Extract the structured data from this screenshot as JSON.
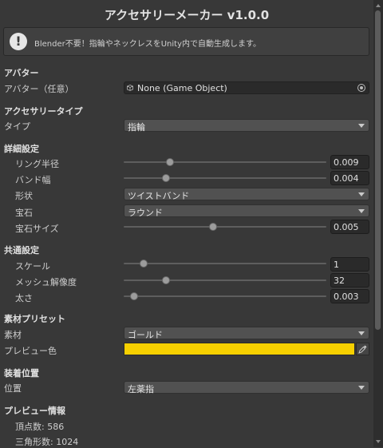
{
  "title": "アクセサリーメーカー v1.0.0",
  "help": {
    "icon": "info-icon",
    "message": "Blender不要！指輪やネックレスをUnity内で自動生成します。"
  },
  "avatar_section": {
    "header": "アバター",
    "field_label": "アバター（任意）",
    "field_value": "None (Game Object)",
    "field_icon": "gameobject-icon",
    "picker_icon": "object-picker-icon"
  },
  "type_section": {
    "header": "アクセサリータイプ",
    "label": "タイプ",
    "value": "指輪"
  },
  "detail_section": {
    "header": "詳細設定",
    "ring_radius": {
      "label": "リング半径",
      "value": "0.009",
      "fraction": 0.23
    },
    "band_width": {
      "label": "バンド幅",
      "value": "0.004",
      "fraction": 0.21
    },
    "shape": {
      "label": "形状",
      "value": "ツイストバンド"
    },
    "gem": {
      "label": "宝石",
      "value": "ラウンド"
    },
    "gem_size": {
      "label": "宝石サイズ",
      "value": "0.005",
      "fraction": 0.44
    }
  },
  "common_section": {
    "header": "共通設定",
    "scale": {
      "label": "スケール",
      "value": "1",
      "fraction": 0.1
    },
    "mesh_resolution": {
      "label": "メッシュ解像度",
      "value": "32",
      "fraction": 0.21
    },
    "thickness": {
      "label": "太さ",
      "value": "0.003",
      "fraction": 0.05
    }
  },
  "material_section": {
    "header": "素材プリセット",
    "material": {
      "label": "素材",
      "value": "ゴールド"
    },
    "preview_color": {
      "label": "プレビュー色",
      "color": "#F7D000",
      "picker_icon": "eyedropper-icon"
    }
  },
  "position_section": {
    "header": "装着位置",
    "label": "位置",
    "value": "左薬指"
  },
  "preview_section": {
    "header": "プレビュー情報",
    "vertices": "頂点数: 586",
    "triangles": "三角形数: 1024"
  }
}
